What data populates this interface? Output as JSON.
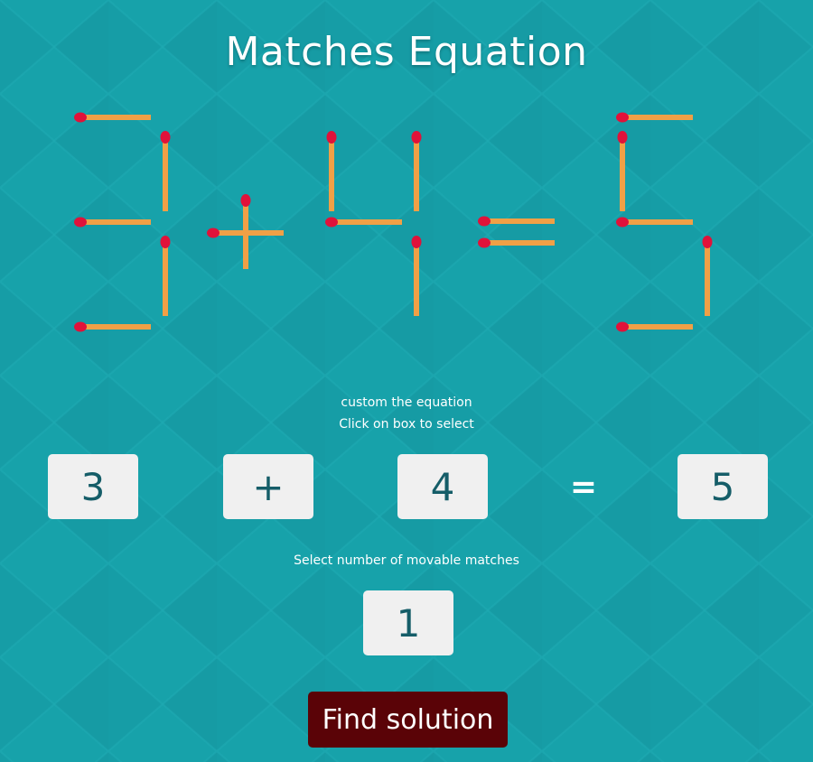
{
  "app": {
    "title": "Matches Equation"
  },
  "colors": {
    "background": "#17a2aa",
    "background_pattern": "#13929a",
    "match_stick": "#f0a046",
    "match_head": "#e0123a",
    "box_bg": "#f0f0f0",
    "box_text": "#155d68",
    "button_bg": "#5a0307"
  },
  "puzzle_display": {
    "equation": [
      "3",
      "+",
      "4",
      "=",
      "5"
    ]
  },
  "custom": {
    "line1": "custom the equation",
    "line2": "Click on box to select"
  },
  "equation_boxes": {
    "left_operand": "3",
    "operator": "+",
    "right_operand": "4",
    "equals": "=",
    "result": "5"
  },
  "movable": {
    "label": "Select number of movable matches",
    "value": "1"
  },
  "actions": {
    "find_solution": "Find solution"
  }
}
